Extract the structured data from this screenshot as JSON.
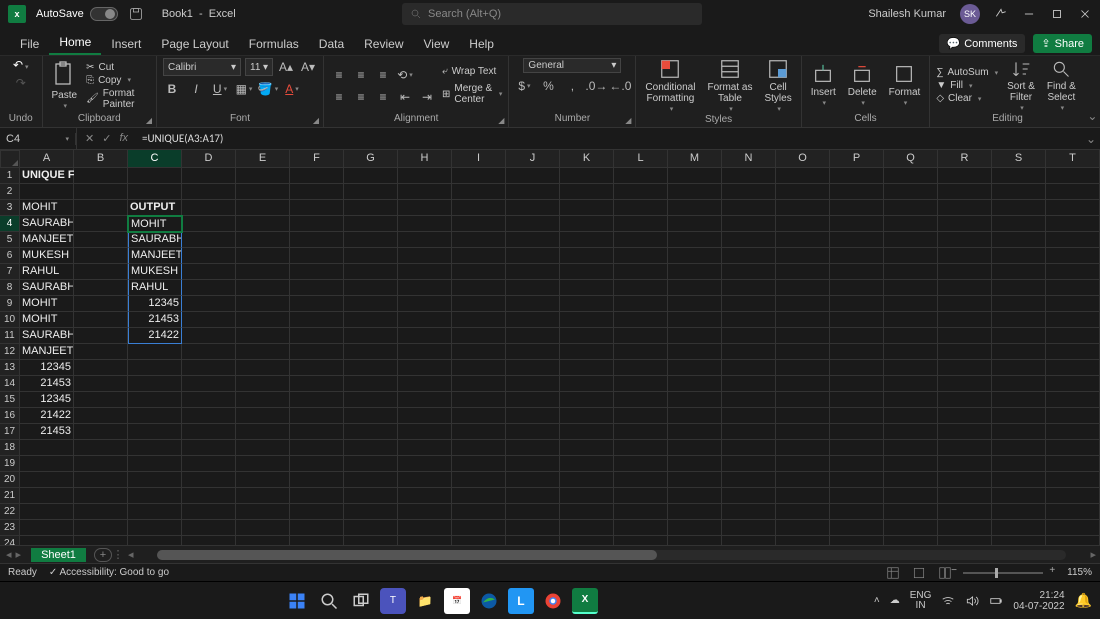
{
  "title": {
    "autosave": "AutoSave",
    "doc": "Book1",
    "app": "Excel",
    "search_ph": "Search (Alt+Q)",
    "user": "Shailesh Kumar",
    "initials": "SK"
  },
  "tabs": [
    "File",
    "Home",
    "Insert",
    "Page Layout",
    "Formulas",
    "Data",
    "Review",
    "View",
    "Help"
  ],
  "tabs_active": 1,
  "comments": "Comments",
  "share": "Share",
  "ribbon": {
    "undo": "Undo",
    "clipboard": {
      "cut": "Cut",
      "copy": "Copy",
      "fmt": "Format Painter",
      "paste": "Paste",
      "label": "Clipboard"
    },
    "font": {
      "name": "Calibri",
      "size": "11",
      "label": "Font"
    },
    "align": {
      "wrap": "Wrap Text",
      "merge": "Merge & Center",
      "label": "Alignment"
    },
    "number": {
      "fmt": "General",
      "label": "Number"
    },
    "styles": {
      "cf": "Conditional\nFormatting",
      "fat": "Format as\nTable",
      "cs": "Cell\nStyles",
      "label": "Styles"
    },
    "cells": {
      "ins": "Insert",
      "del": "Delete",
      "fmt": "Format",
      "label": "Cells"
    },
    "editing": {
      "sum": "AutoSum",
      "fill": "Fill",
      "clear": "Clear",
      "sort": "Sort &\nFilter",
      "find": "Find &\nSelect",
      "label": "Editing"
    }
  },
  "fx": {
    "name": "C4",
    "formula": "=UNIQUE(A3:A17)"
  },
  "columns": [
    "A",
    "B",
    "C",
    "D",
    "E",
    "F",
    "G",
    "H",
    "I",
    "J",
    "K",
    "L",
    "M",
    "N",
    "O",
    "P",
    "Q",
    "R",
    "S",
    "T"
  ],
  "sel_col": 2,
  "rows": [
    {
      "n": 1,
      "A": "UNIQUE FORMULA :-",
      "bold": true,
      "spill": true
    },
    {
      "n": 2
    },
    {
      "n": 3,
      "A": "MOHIT",
      "C": "OUTPUT",
      "Cbold": true
    },
    {
      "n": 4,
      "A": "SAURABH",
      "C": "MOHIT",
      "sel": true
    },
    {
      "n": 5,
      "A": "MANJEET",
      "C": "SAURABH"
    },
    {
      "n": 6,
      "A": "MUKESH",
      "C": "MANJEET"
    },
    {
      "n": 7,
      "A": "RAHUL",
      "C": "MUKESH"
    },
    {
      "n": 8,
      "A": "SAURABH",
      "C": "RAHUL"
    },
    {
      "n": 9,
      "A": "MOHIT",
      "C": "12345",
      "Cright": true
    },
    {
      "n": 10,
      "A": "MOHIT",
      "C": "21453",
      "Cright": true
    },
    {
      "n": 11,
      "A": "SAURABH",
      "C": "21422",
      "Cright": true
    },
    {
      "n": 12,
      "A": "MANJEET"
    },
    {
      "n": 13,
      "A": "12345",
      "Aright": true
    },
    {
      "n": 14,
      "A": "21453",
      "Aright": true
    },
    {
      "n": 15,
      "A": "12345",
      "Aright": true
    },
    {
      "n": 16,
      "A": "21422",
      "Aright": true
    },
    {
      "n": 17,
      "A": "21453",
      "Aright": true
    },
    {
      "n": 18
    },
    {
      "n": 19
    },
    {
      "n": 20
    },
    {
      "n": 21
    },
    {
      "n": 22
    },
    {
      "n": 23
    },
    {
      "n": 24
    }
  ],
  "sheet": {
    "name": "Sheet1"
  },
  "status": {
    "ready": "Ready",
    "acc": "Accessibility: Good to go",
    "zoom": "115%"
  },
  "taskbar": {
    "lang1": "ENG",
    "lang2": "IN",
    "time": "21:24",
    "date": "04-07-2022"
  }
}
